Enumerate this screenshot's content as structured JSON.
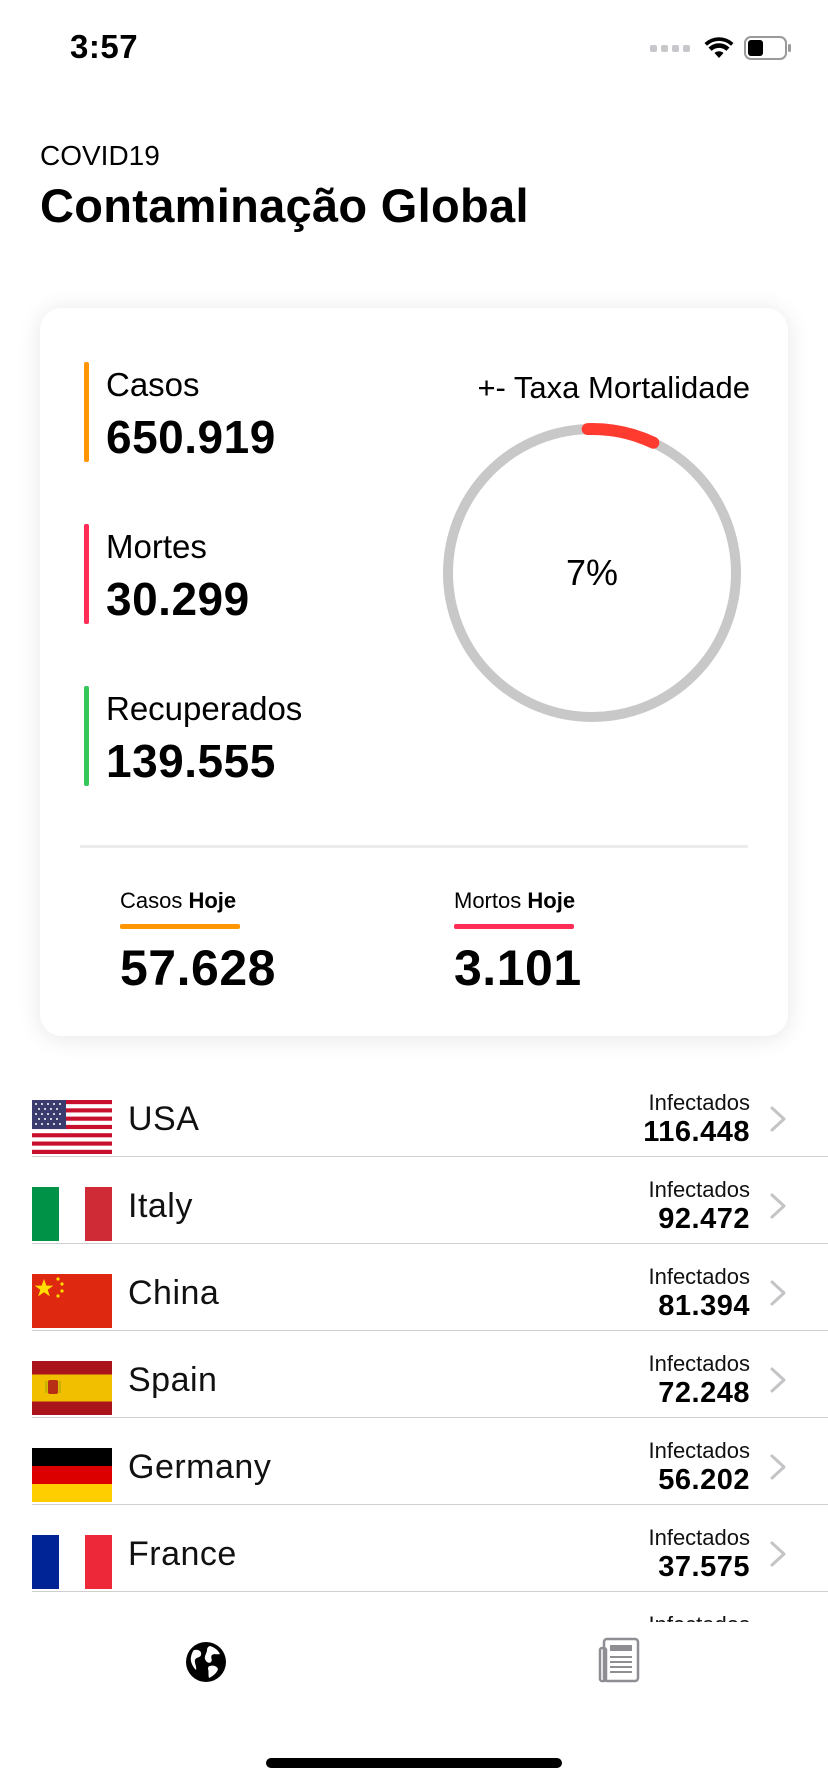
{
  "status_bar": {
    "time": "3:57"
  },
  "header": {
    "subtitle": "COVID19",
    "title": "Contaminação Global"
  },
  "summary": {
    "cases": {
      "label": "Casos",
      "value": "650.919",
      "color": "#ff9500"
    },
    "deaths": {
      "label": "Mortes",
      "value": "30.299",
      "color": "#ff2d55"
    },
    "recovered": {
      "label": "Recuperados",
      "value": "139.555",
      "color": "#34c759"
    },
    "mortality": {
      "title": "+- Taxa Mortalidade",
      "value_text": "7%",
      "fraction": 0.07,
      "ring_color": "#ff3b30",
      "track_color": "#c8c8c8"
    },
    "today_cases": {
      "label_prefix": "Casos",
      "label_bold": "Hoje",
      "value": "57.628",
      "color": "#ff9500"
    },
    "today_deaths": {
      "label_prefix": "Mortos",
      "label_bold": "Hoje",
      "value": "3.101",
      "color": "#ff2d55"
    }
  },
  "countries": [
    {
      "name": "USA",
      "infected_label": "Infectados",
      "infected": "116.448",
      "flag": "usa-flag-icon"
    },
    {
      "name": "Italy",
      "infected_label": "Infectados",
      "infected": "92.472",
      "flag": "italy-flag-icon"
    },
    {
      "name": "China",
      "infected_label": "Infectados",
      "infected": "81.394",
      "flag": "china-flag-icon"
    },
    {
      "name": "Spain",
      "infected_label": "Infectados",
      "infected": "72.248",
      "flag": "spain-flag-icon"
    },
    {
      "name": "Germany",
      "infected_label": "Infectados",
      "infected": "56.202",
      "flag": "germany-flag-icon"
    },
    {
      "name": "France",
      "infected_label": "Infectados",
      "infected": "37.575",
      "flag": "france-flag-icon"
    },
    {
      "name": "",
      "infected_label": "Infectados",
      "infected": "",
      "flag": "partial-flag-icon"
    }
  ],
  "tab_bar": {
    "tabs": [
      {
        "icon": "globe-icon",
        "active": true
      },
      {
        "icon": "newspaper-icon",
        "active": false
      }
    ]
  }
}
